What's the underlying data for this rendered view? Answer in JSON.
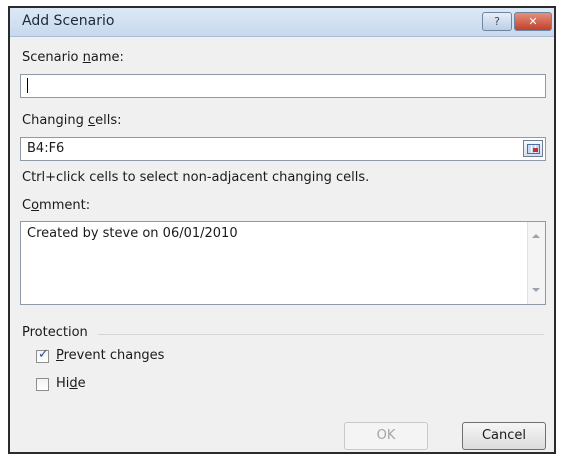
{
  "window": {
    "title": "Add Scenario",
    "help_glyph": "?",
    "close_glyph": "✕"
  },
  "scenario_name": {
    "label_pre": "Scenario ",
    "label_key": "n",
    "label_post": "ame:",
    "value": ""
  },
  "changing_cells": {
    "label_pre": "Changing ",
    "label_key": "c",
    "label_post": "ells:",
    "value": "B4:F6",
    "hint": "Ctrl+click cells to select non-adjacent changing cells."
  },
  "comment": {
    "label_pre": "C",
    "label_key": "o",
    "label_post": "mment:",
    "value": "Created by steve on 06/01/2010"
  },
  "protection": {
    "title": "Protection",
    "prevent_changes": {
      "checked": true,
      "label_key": "P",
      "label_post": "revent changes"
    },
    "hide": {
      "checked": false,
      "label_pre": "Hi",
      "label_key": "d",
      "label_post": "e"
    }
  },
  "buttons": {
    "ok": "OK",
    "cancel": "Cancel"
  }
}
